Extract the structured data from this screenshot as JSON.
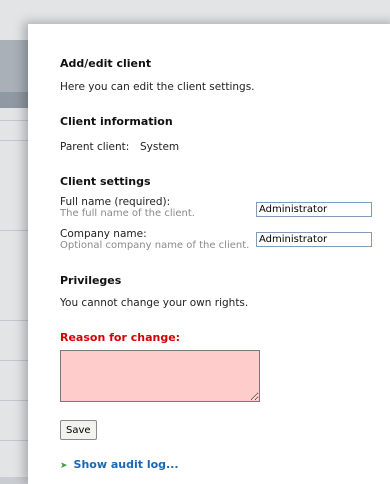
{
  "dialog": {
    "title": "Add/edit client",
    "intro": "Here you can edit the client settings.",
    "client_information": {
      "heading": "Client information",
      "parent_label": "Parent client:",
      "parent_value": "System"
    },
    "client_settings": {
      "heading": "Client settings",
      "full_name_label": "Full name (required):",
      "full_name_hint": "The full name of the client.",
      "full_name_value": "Administrator",
      "company_name_label": "Company name:",
      "company_name_hint": "Optional company name of the client.",
      "company_name_value": "Administrator"
    },
    "privileges": {
      "heading": "Privileges",
      "text": "You cannot change your own rights."
    },
    "reason": {
      "label": "Reason for change:",
      "value": ""
    },
    "save_label": "Save",
    "audit_link": "Show audit log..."
  },
  "colors": {
    "reason_label": "#d40000",
    "reason_box_bg": "#ffcccc",
    "link": "#1a68b5",
    "arrow": "#3aa040"
  },
  "icons": {
    "audit_arrow": "green-arrow-right-icon"
  }
}
